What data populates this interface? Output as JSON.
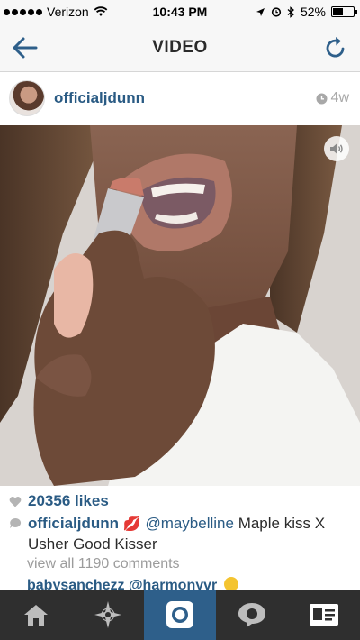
{
  "status_bar": {
    "carrier": "Verizon",
    "time": "10:43 PM",
    "battery": "52%",
    "battery_level": 0.52
  },
  "nav": {
    "title": "VIDEO"
  },
  "post": {
    "username": "officialjdunn",
    "age": "4w",
    "likes": "20356 likes",
    "caption_user": "officialjdunn",
    "caption_mention": "@maybelline",
    "caption_text_1": " Maple kiss X",
    "caption_text_2": "Usher Good Kisser",
    "view_comments": "view all 1190 comments",
    "comment_user": "babysanchezz",
    "comment_mention": "@harmonyvr"
  },
  "tabs": [
    {
      "name": "home",
      "icon": "home-icon"
    },
    {
      "name": "explore",
      "icon": "star-icon"
    },
    {
      "name": "camera",
      "icon": "camera-icon",
      "active": true
    },
    {
      "name": "activity",
      "icon": "speech-bubble-icon"
    },
    {
      "name": "profile",
      "icon": "profile-card-icon"
    }
  ],
  "colors": {
    "link_blue": "#2a5b84",
    "tab_bar": "#2f2f2f",
    "active_tab": "#2e5f8a"
  }
}
